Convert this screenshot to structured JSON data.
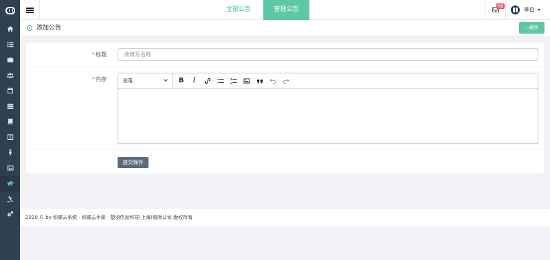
{
  "sidebar": {
    "logo": "app-logo",
    "items": [
      {
        "icon": "home-icon",
        "active": false
      },
      {
        "icon": "list-icon",
        "active": false
      },
      {
        "icon": "briefcase-icon",
        "active": false
      },
      {
        "icon": "users-icon",
        "active": false
      },
      {
        "icon": "calendar-icon",
        "active": false
      },
      {
        "icon": "stack-icon",
        "active": false
      },
      {
        "icon": "book-icon",
        "active": false
      },
      {
        "icon": "columns-icon",
        "active": false
      },
      {
        "icon": "person-icon",
        "active": false
      },
      {
        "icon": "image-icon",
        "active": false
      },
      {
        "icon": "bullhorn-icon",
        "active": true
      },
      {
        "icon": "gavel-icon",
        "active": false
      },
      {
        "icon": "cogs-icon",
        "active": false
      }
    ]
  },
  "header": {
    "tabs": [
      {
        "label": "全部公告",
        "active": false
      },
      {
        "label": "管理公告",
        "active": true
      }
    ],
    "message_count": "68",
    "user_name": "李白"
  },
  "page": {
    "title": "添加公告",
    "back_label": "返回"
  },
  "form": {
    "title_label": "标题",
    "title_placeholder": "请填写名称",
    "title_value": "",
    "content_label": "内容",
    "editor": {
      "format_selected": "段落",
      "tools": [
        "bold-icon",
        "italic-icon",
        "link-icon",
        "bullet-list-icon",
        "numbered-list-icon",
        "image-icon",
        "quote-icon",
        "undo-icon",
        "redo-icon"
      ]
    },
    "submit_label": "提交保存"
  },
  "footer": {
    "text": "2020 © by 织蝶云系统 · 织蝶云手册 · 楚羽信息科技(上海)有限公司 版权所有"
  },
  "colors": {
    "sidebar_bg": "#2f4050",
    "accent": "#5cc8a4",
    "submit_bg": "#5c6b7e",
    "badge": "#ed5565"
  }
}
